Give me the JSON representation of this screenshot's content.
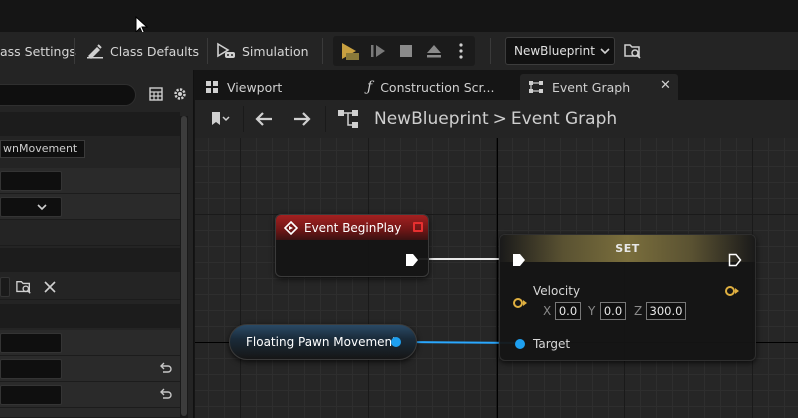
{
  "toolbar": {
    "class_settings_label": "ass Settings",
    "class_defaults_label": "Class Defaults",
    "simulation_label": "Simulation",
    "blueprint_combo_value": "NewBlueprint"
  },
  "left_panel": {
    "component_field_text": "wnMovement"
  },
  "tabs": [
    {
      "label": "Viewport"
    },
    {
      "label": "Construction Scr..."
    },
    {
      "label": "Event Graph"
    }
  ],
  "graph_toolbar": {
    "breadcrumb_root": "NewBlueprint",
    "breadcrumb_separator": ">",
    "breadcrumb_current": "Event Graph"
  },
  "graph": {
    "begin_node_title": "Event BeginPlay",
    "set_node_title": "SET",
    "velocity_label": "Velocity",
    "target_label": "Target",
    "vector": {
      "x_label": "X",
      "x_value": "0.0",
      "y_label": "Y",
      "y_value": "0.0",
      "z_label": "Z",
      "z_value": "300.0"
    },
    "component_node_title": "Floating Pawn Movement"
  },
  "colors": {
    "exec_pin": "#ffffff",
    "struct_pin": "#e0b040",
    "object_pin": "#1ea0f0",
    "event_header": "#a32020",
    "set_header": "#7a6e3c"
  }
}
